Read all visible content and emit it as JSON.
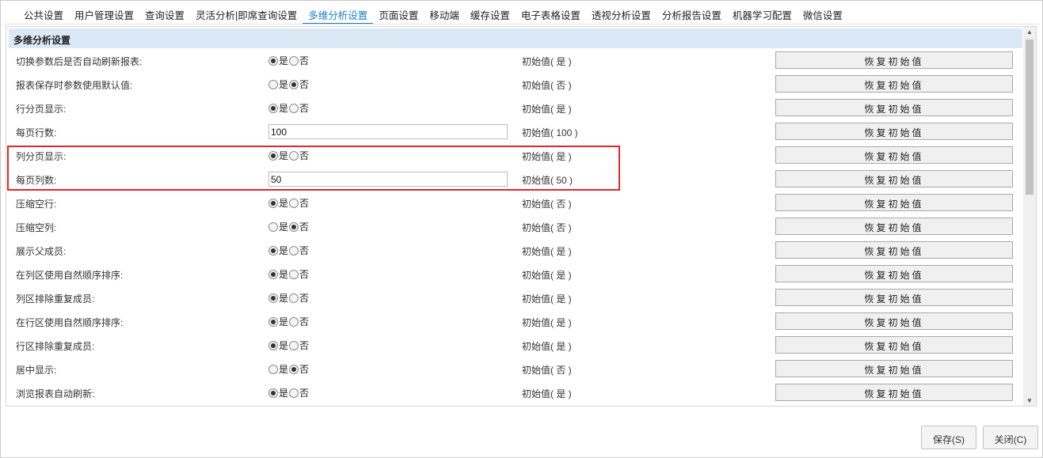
{
  "tabs": [
    {
      "label": "公共设置"
    },
    {
      "label": "用户管理设置"
    },
    {
      "label": "查询设置"
    },
    {
      "label": "灵活分析|即席查询设置"
    },
    {
      "label": "多维分析设置",
      "active": true
    },
    {
      "label": "页面设置"
    },
    {
      "label": "移动端"
    },
    {
      "label": "缓存设置"
    },
    {
      "label": "电子表格设置"
    },
    {
      "label": "透视分析设置"
    },
    {
      "label": "分析报告设置"
    },
    {
      "label": "机器学习配置"
    },
    {
      "label": "微信设置"
    }
  ],
  "section_title": "多维分析设置",
  "yes_label": "是",
  "no_label": "否",
  "restore_label": "恢复初始值",
  "rows": [
    {
      "label": "切换参数后是否自动刷新报表:",
      "type": "radio",
      "value": "是",
      "initial": "初始值( 是 )"
    },
    {
      "label": "报表保存时参数使用默认值:",
      "type": "radio",
      "value": "否",
      "initial": "初始值( 否 )"
    },
    {
      "label": "行分页显示:",
      "type": "radio",
      "value": "是",
      "initial": "初始值( 是 )"
    },
    {
      "label": "每页行数:",
      "type": "input",
      "value": "100",
      "initial": "初始值( 100 )"
    },
    {
      "label": "列分页显示:",
      "type": "radio",
      "value": "是",
      "initial": "初始值( 是 )"
    },
    {
      "label": "每页列数:",
      "type": "input",
      "value": "50",
      "initial": "初始值( 50 )"
    },
    {
      "label": "压缩空行:",
      "type": "radio",
      "value": "是",
      "initial": "初始值( 否 )"
    },
    {
      "label": "压缩空列:",
      "type": "radio",
      "value": "否",
      "initial": "初始值( 否 )"
    },
    {
      "label": "展示父成员:",
      "type": "radio",
      "value": "是",
      "initial": "初始值( 是 )"
    },
    {
      "label": "在列区使用自然顺序排序:",
      "type": "radio",
      "value": "是",
      "initial": "初始值( 是 )"
    },
    {
      "label": "列区排除重复成员:",
      "type": "radio",
      "value": "是",
      "initial": "初始值( 是 )"
    },
    {
      "label": "在行区使用自然顺序排序:",
      "type": "radio",
      "value": "是",
      "initial": "初始值( 是 )"
    },
    {
      "label": "行区排除重复成员:",
      "type": "radio",
      "value": "是",
      "initial": "初始值( 是 )"
    },
    {
      "label": "居中显示:",
      "type": "radio",
      "value": "否",
      "initial": "初始值( 否 )"
    },
    {
      "label": "浏览报表自动刷新:",
      "type": "radio",
      "value": "是",
      "initial": "初始值( 是 )"
    }
  ],
  "footer": {
    "save_label": "保存(S)",
    "close_label": "关闭(C)"
  },
  "colors": {
    "accent": "#1b7fc4",
    "section_bg": "#dbe9f7",
    "highlight": "#e0282c"
  }
}
